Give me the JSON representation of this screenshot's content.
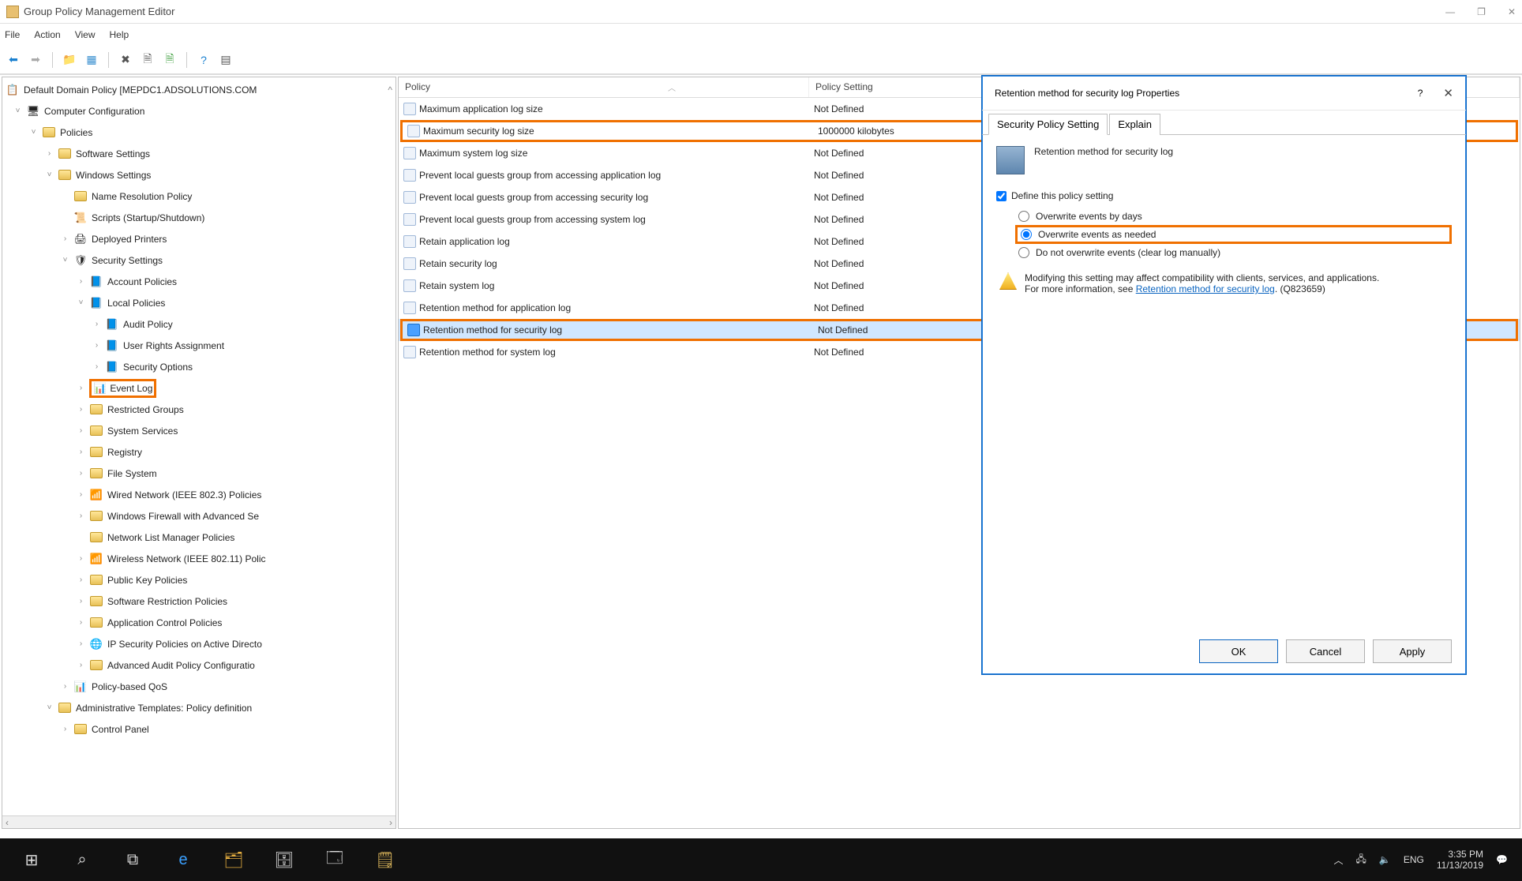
{
  "window": {
    "title": "Group Policy Management Editor"
  },
  "menu": {
    "file": "File",
    "action": "Action",
    "view": "View",
    "help": "Help"
  },
  "tree": {
    "root": "Default Domain Policy [MEPDC1.ADSOLUTIONS.COM",
    "computercfg": "Computer Configuration",
    "policies": "Policies",
    "softset": "Software Settings",
    "winset": "Windows Settings",
    "nameres": "Name Resolution Policy",
    "scripts": "Scripts (Startup/Shutdown)",
    "deployed": "Deployed Printers",
    "secset": "Security Settings",
    "accpol": "Account Policies",
    "localpol": "Local Policies",
    "audit": "Audit Policy",
    "ura": "User Rights Assignment",
    "secopt": "Security Options",
    "eventlog": "Event Log",
    "restricted": "Restricted Groups",
    "syssvc": "System Services",
    "registry": "Registry",
    "filesys": "File System",
    "wired": "Wired Network (IEEE 802.3) Policies",
    "firewall": "Windows Firewall with Advanced Se",
    "netlist": "Network List Manager Policies",
    "wireless": "Wireless Network (IEEE 802.11) Polic",
    "pubkey": "Public Key Policies",
    "softrestrict": "Software Restriction Policies",
    "appctrl": "Application Control Policies",
    "ipsec": "IP Security Policies on Active Directo",
    "advaudit": "Advanced Audit Policy Configuratio",
    "qos": "Policy-based QoS",
    "admtpl": "Administrative Templates: Policy definition",
    "cpanel": "Control Panel"
  },
  "list": {
    "cols": {
      "policy": "Policy",
      "setting": "Policy Setting"
    },
    "rows": [
      {
        "name": "Maximum application log size",
        "val": "Not Defined"
      },
      {
        "name": "Maximum security log size",
        "val": "1000000 kilobytes",
        "hl": true
      },
      {
        "name": "Maximum system log size",
        "val": "Not Defined"
      },
      {
        "name": "Prevent local guests group from accessing application log",
        "val": "Not Defined"
      },
      {
        "name": "Prevent local guests group from accessing security log",
        "val": "Not Defined"
      },
      {
        "name": "Prevent local guests group from accessing system log",
        "val": "Not Defined"
      },
      {
        "name": "Retain application log",
        "val": "Not Defined"
      },
      {
        "name": "Retain security log",
        "val": "Not Defined"
      },
      {
        "name": "Retain system log",
        "val": "Not Defined"
      },
      {
        "name": "Retention method for application log",
        "val": "Not Defined"
      },
      {
        "name": "Retention method for security log",
        "val": "Not Defined",
        "sel": true,
        "hl": true
      },
      {
        "name": "Retention method for system log",
        "val": "Not Defined"
      }
    ]
  },
  "dlg": {
    "title": "Retention method for security log Properties",
    "tab1": "Security Policy Setting",
    "tab2": "Explain",
    "heading": "Retention method for security log",
    "define": "Define this policy setting",
    "opt1": "Overwrite events by days",
    "opt2": "Overwrite events as needed",
    "opt3": "Do not overwrite events (clear log manually)",
    "warn1": "Modifying this setting may affect compatibility with clients, services, and applications.",
    "warn2a": "For more information, see ",
    "warn2link": "Retention method for security log",
    "warn2b": ". (Q823659)",
    "ok": "OK",
    "cancel": "Cancel",
    "apply": "Apply"
  },
  "taskbar": {
    "lang": "ENG",
    "time": "3:35 PM",
    "date": "11/13/2019"
  }
}
